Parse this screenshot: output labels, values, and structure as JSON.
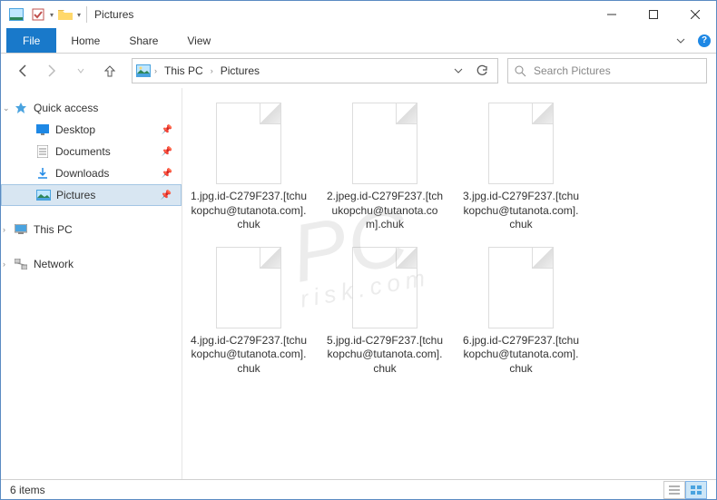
{
  "window": {
    "title": "Pictures"
  },
  "ribbon": {
    "file": "File",
    "tabs": [
      "Home",
      "Share",
      "View"
    ]
  },
  "breadcrumb": {
    "items": [
      "This PC",
      "Pictures"
    ]
  },
  "search": {
    "placeholder": "Search Pictures"
  },
  "nav": {
    "quick_access": "Quick access",
    "items": [
      {
        "icon": "desktop",
        "label": "Desktop"
      },
      {
        "icon": "document",
        "label": "Documents"
      },
      {
        "icon": "download",
        "label": "Downloads"
      },
      {
        "icon": "picture",
        "label": "Pictures",
        "selected": true
      }
    ],
    "this_pc": "This PC",
    "network": "Network"
  },
  "files": [
    {
      "name": "1.jpg.id-C279F237.[tchukopchu@tutanota.com].chuk"
    },
    {
      "name": "2.jpeg.id-C279F237.[tchukopchu@tutanota.com].chuk"
    },
    {
      "name": "3.jpg.id-C279F237.[tchukopchu@tutanota.com].chuk"
    },
    {
      "name": "4.jpg.id-C279F237.[tchukopchu@tutanota.com].chuk"
    },
    {
      "name": "5.jpg.id-C279F237.[tchukopchu@tutanota.com].chuk"
    },
    {
      "name": "6.jpg.id-C279F237.[tchukopchu@tutanota.com].chuk"
    }
  ],
  "status": {
    "count": "6 items"
  },
  "watermark": {
    "main": "PC",
    "sub": "risk.com"
  }
}
